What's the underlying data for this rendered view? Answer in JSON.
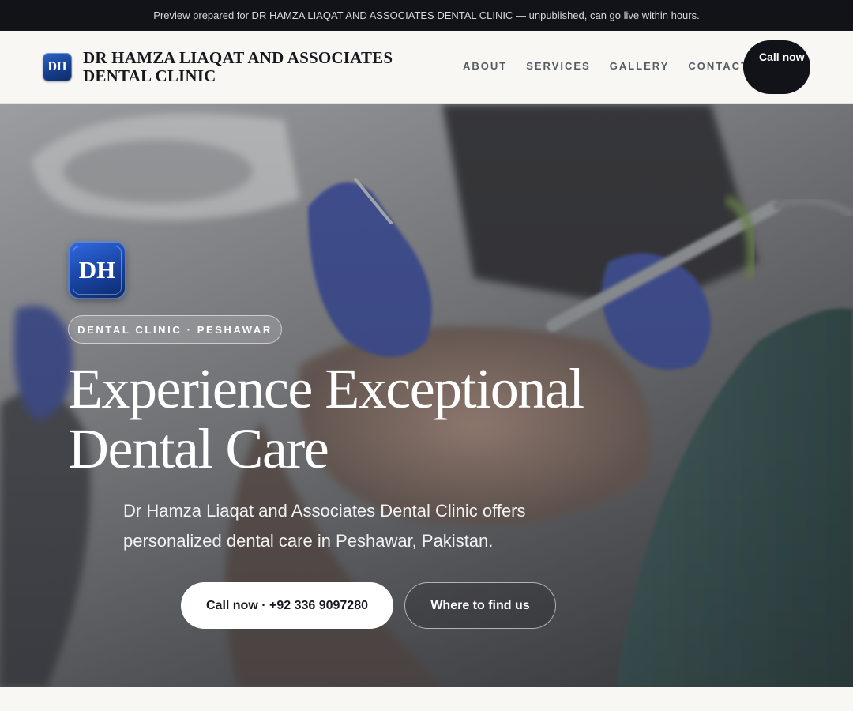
{
  "banner": {
    "text": "Preview prepared for DR HAMZA LIAQAT AND ASSOCIATES DENTAL CLINIC — unpublished, can go live within hours."
  },
  "header": {
    "logo_initials": "DH",
    "brand_name": "DR HAMZA LIAQAT AND ASSOCIATES DENTAL CLINIC",
    "nav": [
      "ABOUT",
      "SERVICES",
      "GALLERY",
      "CONTACT"
    ],
    "cta_label": "Call now"
  },
  "hero": {
    "logo_initials": "DH",
    "badge": "DENTAL CLINIC · PESHAWAR",
    "headline": "Experience Exceptional Dental Care",
    "subtitle": "Dr Hamza Liaqat and Associates Dental Clinic offers personalized dental care in Peshawar, Pakistan.",
    "primary_button": "Call now · +92 336 9097280",
    "secondary_button": "Where to find us",
    "background_image": "dentist-treating-patient-photo"
  },
  "colors": {
    "dark": "#111318",
    "page_bg": "#f8f7f4",
    "logo_blue": "#1a46a6",
    "glove_blue": "#4a5aa8"
  }
}
